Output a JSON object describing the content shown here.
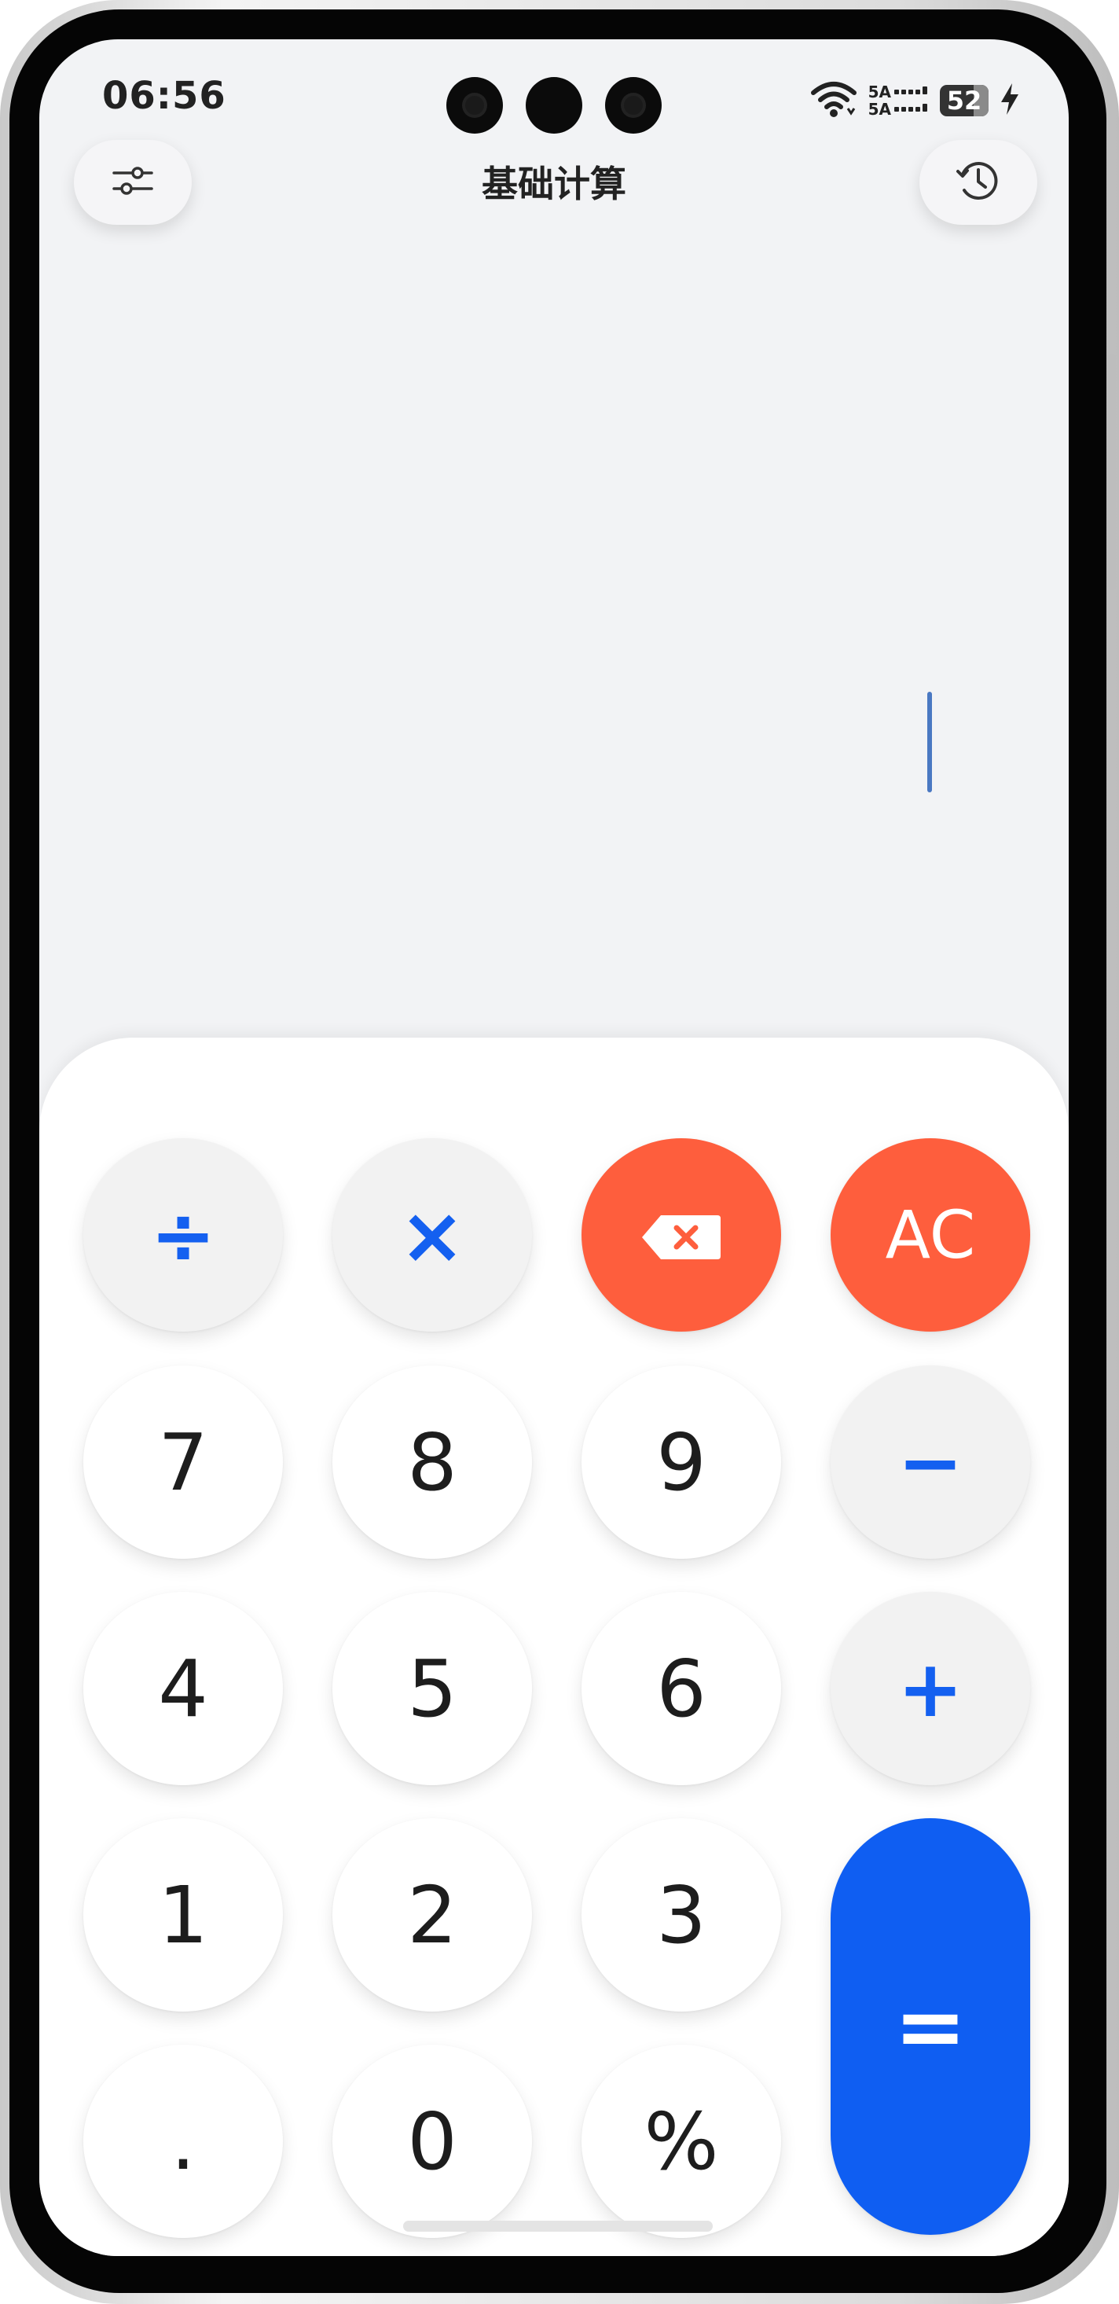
{
  "status_bar": {
    "time": "06:56",
    "network_line1": "5A",
    "network_line2": "5A",
    "battery": "52",
    "icons": [
      "wifi-icon",
      "signal-icon",
      "battery-icon",
      "charging-icon"
    ]
  },
  "header": {
    "title": "基础计算",
    "left_button_icon": "sliders-icon",
    "right_button_icon": "history-icon"
  },
  "display": {
    "expression": "",
    "result": ""
  },
  "keys": {
    "divide": "÷",
    "multiply": "×",
    "backspace_icon": "backspace-icon",
    "clear": "AC",
    "seven": "7",
    "eight": "8",
    "nine": "9",
    "minus": "−",
    "four": "4",
    "five": "5",
    "six": "6",
    "plus": "+",
    "one": "1",
    "two": "2",
    "three": "3",
    "equals": "=",
    "dot": ".",
    "zero": "0",
    "percent": "%"
  },
  "colors": {
    "accent_blue": "#1460f0",
    "equals_blue": "#0f5ef2",
    "danger_red": "#fe5e3d",
    "screen_bg": "#f2f3f5"
  }
}
